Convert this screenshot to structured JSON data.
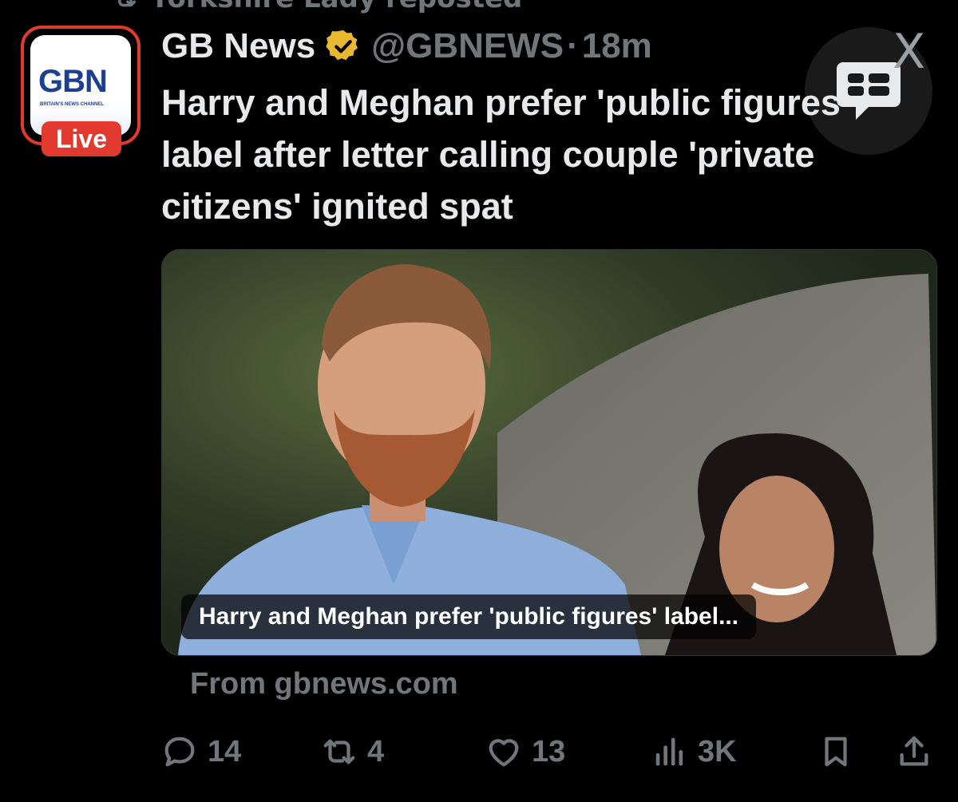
{
  "repost": {
    "label": "Yorkshire Lady reposted",
    "icon": "repost-icon"
  },
  "post": {
    "author": {
      "name": "GB News",
      "handle": "@GBNEWS",
      "verified_icon": "gold-verified-badge-icon",
      "avatar": {
        "logo_text": "GBN",
        "logo_sub": "BRITAIN'S NEWS CHANNEL",
        "live_label": "Live"
      }
    },
    "separator": "·",
    "time": "18m",
    "headline": "Harry and Meghan prefer 'public figures' label after letter calling couple 'private citizens' ignited spat",
    "card": {
      "caption": "Harry and Meghan prefer 'public figures' label...",
      "source": "From gbnews.com"
    },
    "actions": {
      "replies": "14",
      "reposts": "4",
      "likes": "13",
      "views": "3K"
    }
  },
  "overlay": {
    "x_logo": "X"
  },
  "colors": {
    "background": "#000000",
    "text_primary": "#e7e9ea",
    "text_secondary": "#71767b",
    "brand_red": "#e23a2e",
    "brand_blue": "#1c3f94",
    "verified_gold": "#e8b831"
  }
}
